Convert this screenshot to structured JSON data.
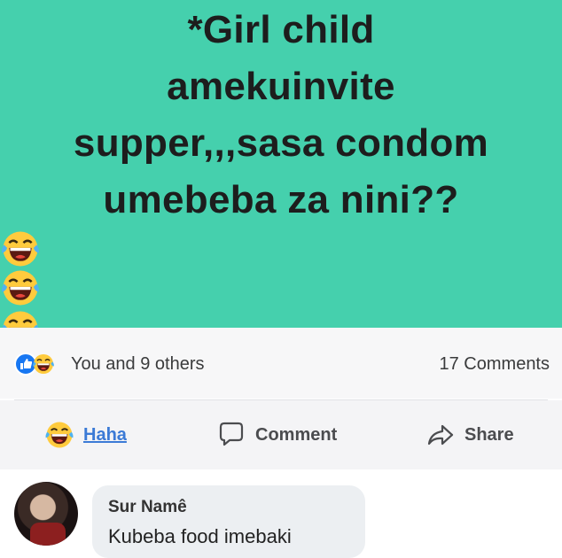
{
  "post": {
    "line1": "*Girl child",
    "line2": "amekuinvite",
    "line3": "supper,,,sasa condom",
    "line4": "umebeba za nini??",
    "trail": "*",
    "background_color": "#45d0ad",
    "emoji_icon": "laughing-tears-emoji"
  },
  "reactions": {
    "summary": "You and 9 others",
    "comments_count": "17 Comments"
  },
  "actions": {
    "haha_label": "Haha",
    "comment_label": "Comment",
    "share_label": "Share"
  },
  "comment": {
    "author": "Sur Namê",
    "text": "Kubeba food imebaki"
  }
}
